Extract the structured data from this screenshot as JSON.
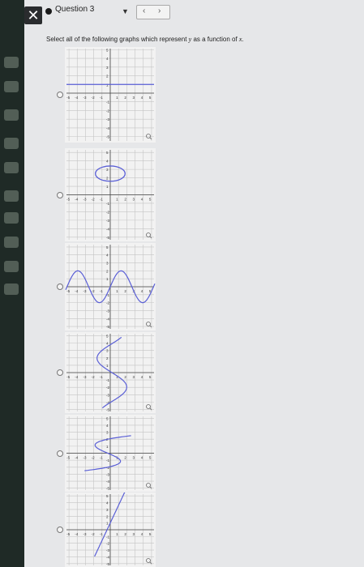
{
  "header": {
    "question_label": "Question 3",
    "close_glyph": "✕",
    "nav_prev": "‹",
    "nav_next": "›"
  },
  "prompt": {
    "text": "Select all of the following graphs which represent ",
    "var_y": "y",
    "mid": " as a function of ",
    "var_x": "x",
    "end": "."
  },
  "options": [
    {
      "id": "A",
      "shape": "horizontal-line",
      "curve_color": "#5a5fd6"
    },
    {
      "id": "B",
      "shape": "ellipse",
      "curve_color": "#5a5fd6"
    },
    {
      "id": "C",
      "shape": "sine-wave",
      "curve_color": "#5a5fd6"
    },
    {
      "id": "D",
      "shape": "vertical-s-curve",
      "curve_color": "#5a5fd6"
    },
    {
      "id": "E",
      "shape": "sideways-curve",
      "curve_color": "#5a5fd6"
    },
    {
      "id": "F",
      "shape": "steep-line",
      "curve_color": "#5a5fd6"
    }
  ],
  "axis_ticks": [
    "-5",
    "-4",
    "-3",
    "-2",
    "-1",
    "1",
    "2",
    "3",
    "4",
    "5"
  ],
  "y_ticks": [
    "5",
    "4",
    "3",
    "2",
    "1",
    "-1",
    "-2",
    "-3",
    "-4",
    "-5"
  ],
  "zoom_icon": "magnifier-icon"
}
